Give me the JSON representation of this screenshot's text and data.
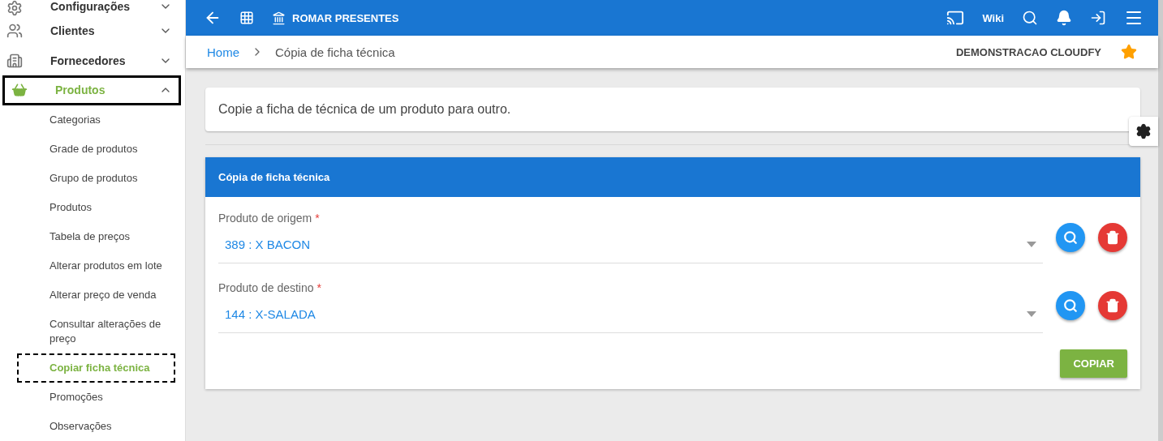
{
  "sidebar": {
    "items": [
      {
        "label": "Configurações",
        "expanded": false,
        "selected": false
      },
      {
        "label": "Clientes",
        "expanded": false,
        "selected": false
      },
      {
        "label": "Fornecedores",
        "expanded": false,
        "selected": false
      },
      {
        "label": "Produtos",
        "expanded": true,
        "selected": true,
        "children": [
          {
            "label": "Categorias",
            "selected": false
          },
          {
            "label": "Grade de produtos",
            "selected": false
          },
          {
            "label": "Grupo de produtos",
            "selected": false
          },
          {
            "label": "Produtos",
            "selected": false
          },
          {
            "label": "Tabela de preços",
            "selected": false
          },
          {
            "label": "Alterar produtos em lote",
            "selected": false
          },
          {
            "label": "Alterar preço de venda",
            "selected": false
          },
          {
            "label": "Consultar alterações de preço",
            "selected": false
          },
          {
            "label": "Copiar ficha técnica",
            "selected": true
          },
          {
            "label": "Promoções",
            "selected": false
          },
          {
            "label": "Observações",
            "selected": false
          }
        ]
      }
    ]
  },
  "topbar": {
    "company": "ROMAR PRESENTES",
    "wiki": "Wiki"
  },
  "breadcrumb": {
    "items": [
      "Home",
      "Cópia de ficha técnica"
    ],
    "account": "DEMONSTRACAO CLOUDFY",
    "favorite": true
  },
  "description": "Copie a ficha de técnica de um produto para outro.",
  "form": {
    "title": "Cópia de ficha técnica",
    "fields": [
      {
        "label": "Produto de origem",
        "required_mark": "*",
        "value": "389 : X BACON"
      },
      {
        "label": "Produto de destino",
        "required_mark": "*",
        "value": "144 : X-SALADA"
      }
    ],
    "submit": "COPIAR"
  }
}
